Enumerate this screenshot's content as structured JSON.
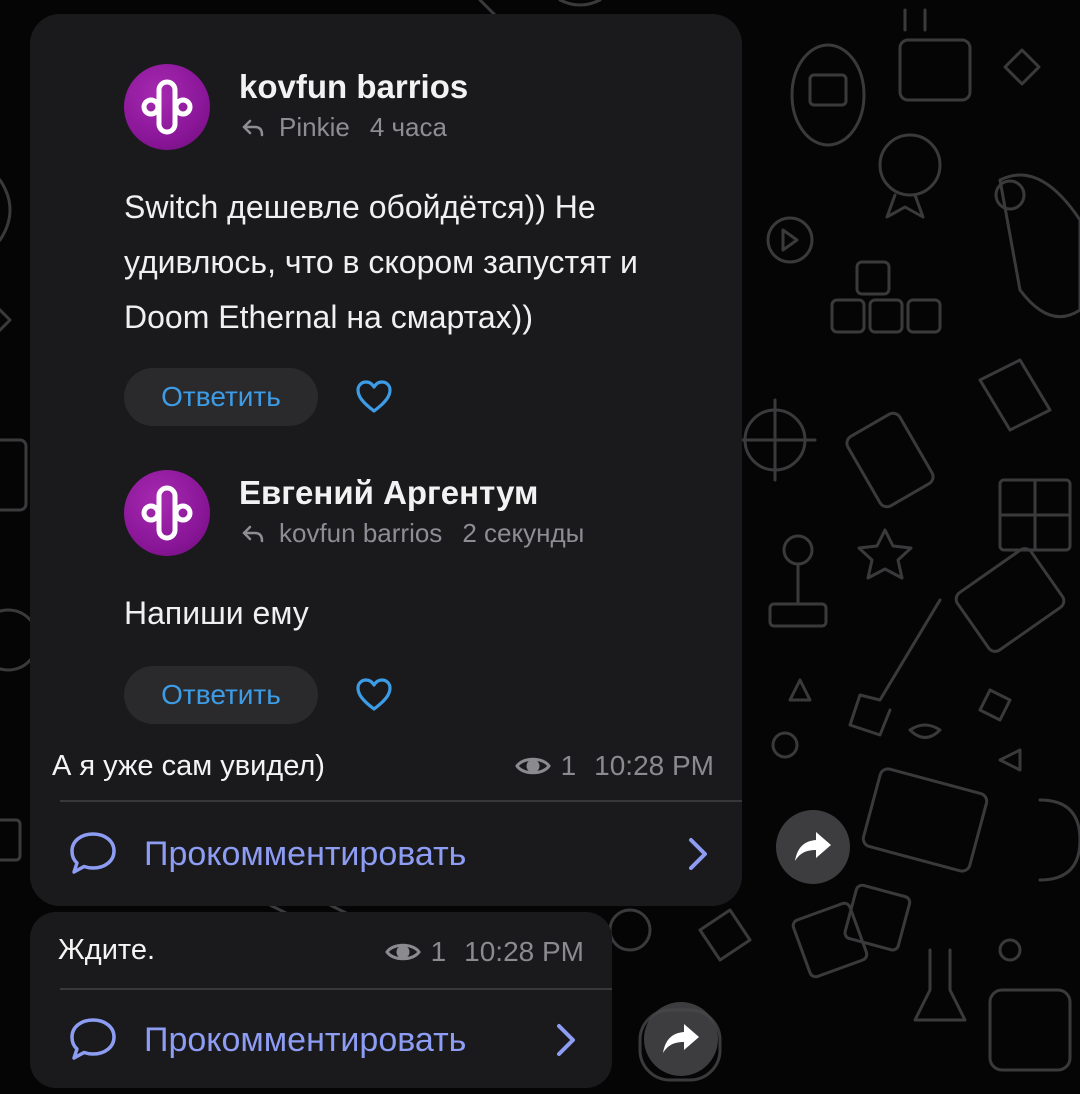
{
  "colors": {
    "background": "#050505",
    "bubble": "#1a1a1c",
    "reply_link": "#3d9ce6",
    "comment_link": "#8e9df4",
    "meta_text": "#8a8a8f",
    "avatar": "#8a1698"
  },
  "icons": {
    "avatar": "vk-avatar-icon",
    "reply": "reply-arrow-icon",
    "like": "heart-outline-icon",
    "views": "eye-icon",
    "comment": "speech-bubble-icon",
    "open": "chevron-right-icon",
    "share": "share-arrow-icon"
  },
  "post_comments": [
    {
      "author": "kovfun barrios",
      "reply_to": "Pinkie",
      "time": "4 часа",
      "text_lines": [
        "Switch дешевле обойдётся)) Не",
        "удивлюсь, что в скором запустят и",
        "Doom Ethernal на смартах))"
      ],
      "reply_label": "Ответить"
    },
    {
      "author": "Евгений Аргентум",
      "reply_to": "kovfun barrios",
      "time": "2 секунды",
      "text_lines": [
        "Напиши ему"
      ],
      "reply_label": "Ответить"
    }
  ],
  "messages": [
    {
      "text": "А я уже сам увидел)",
      "views": "1",
      "time": "10:28 PM",
      "comment_label": "Прокомментировать"
    },
    {
      "text": "Ждите.",
      "views": "1",
      "time": "10:28 PM",
      "comment_label": "Прокомментировать"
    }
  ]
}
